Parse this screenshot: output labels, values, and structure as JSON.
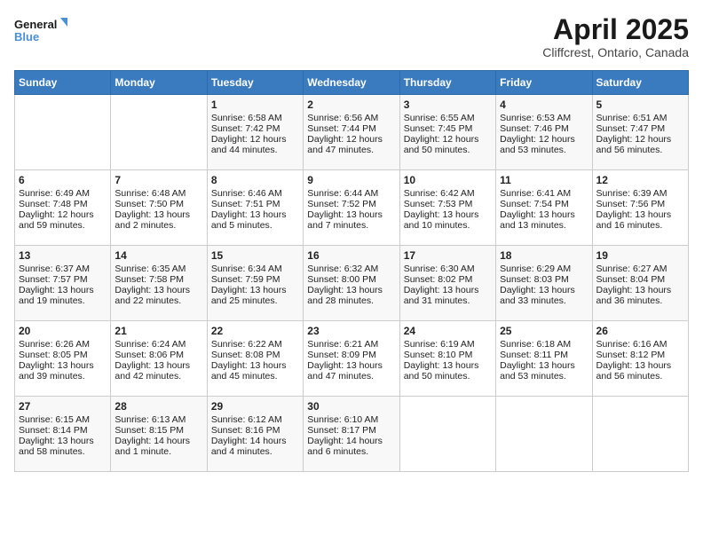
{
  "header": {
    "logo_line1": "General",
    "logo_line2": "Blue",
    "month": "April 2025",
    "location": "Cliffcrest, Ontario, Canada"
  },
  "weekdays": [
    "Sunday",
    "Monday",
    "Tuesday",
    "Wednesday",
    "Thursday",
    "Friday",
    "Saturday"
  ],
  "weeks": [
    [
      {
        "day": "",
        "info": ""
      },
      {
        "day": "",
        "info": ""
      },
      {
        "day": "1",
        "info": "Sunrise: 6:58 AM\nSunset: 7:42 PM\nDaylight: 12 hours and 44 minutes."
      },
      {
        "day": "2",
        "info": "Sunrise: 6:56 AM\nSunset: 7:44 PM\nDaylight: 12 hours and 47 minutes."
      },
      {
        "day": "3",
        "info": "Sunrise: 6:55 AM\nSunset: 7:45 PM\nDaylight: 12 hours and 50 minutes."
      },
      {
        "day": "4",
        "info": "Sunrise: 6:53 AM\nSunset: 7:46 PM\nDaylight: 12 hours and 53 minutes."
      },
      {
        "day": "5",
        "info": "Sunrise: 6:51 AM\nSunset: 7:47 PM\nDaylight: 12 hours and 56 minutes."
      }
    ],
    [
      {
        "day": "6",
        "info": "Sunrise: 6:49 AM\nSunset: 7:48 PM\nDaylight: 12 hours and 59 minutes."
      },
      {
        "day": "7",
        "info": "Sunrise: 6:48 AM\nSunset: 7:50 PM\nDaylight: 13 hours and 2 minutes."
      },
      {
        "day": "8",
        "info": "Sunrise: 6:46 AM\nSunset: 7:51 PM\nDaylight: 13 hours and 5 minutes."
      },
      {
        "day": "9",
        "info": "Sunrise: 6:44 AM\nSunset: 7:52 PM\nDaylight: 13 hours and 7 minutes."
      },
      {
        "day": "10",
        "info": "Sunrise: 6:42 AM\nSunset: 7:53 PM\nDaylight: 13 hours and 10 minutes."
      },
      {
        "day": "11",
        "info": "Sunrise: 6:41 AM\nSunset: 7:54 PM\nDaylight: 13 hours and 13 minutes."
      },
      {
        "day": "12",
        "info": "Sunrise: 6:39 AM\nSunset: 7:56 PM\nDaylight: 13 hours and 16 minutes."
      }
    ],
    [
      {
        "day": "13",
        "info": "Sunrise: 6:37 AM\nSunset: 7:57 PM\nDaylight: 13 hours and 19 minutes."
      },
      {
        "day": "14",
        "info": "Sunrise: 6:35 AM\nSunset: 7:58 PM\nDaylight: 13 hours and 22 minutes."
      },
      {
        "day": "15",
        "info": "Sunrise: 6:34 AM\nSunset: 7:59 PM\nDaylight: 13 hours and 25 minutes."
      },
      {
        "day": "16",
        "info": "Sunrise: 6:32 AM\nSunset: 8:00 PM\nDaylight: 13 hours and 28 minutes."
      },
      {
        "day": "17",
        "info": "Sunrise: 6:30 AM\nSunset: 8:02 PM\nDaylight: 13 hours and 31 minutes."
      },
      {
        "day": "18",
        "info": "Sunrise: 6:29 AM\nSunset: 8:03 PM\nDaylight: 13 hours and 33 minutes."
      },
      {
        "day": "19",
        "info": "Sunrise: 6:27 AM\nSunset: 8:04 PM\nDaylight: 13 hours and 36 minutes."
      }
    ],
    [
      {
        "day": "20",
        "info": "Sunrise: 6:26 AM\nSunset: 8:05 PM\nDaylight: 13 hours and 39 minutes."
      },
      {
        "day": "21",
        "info": "Sunrise: 6:24 AM\nSunset: 8:06 PM\nDaylight: 13 hours and 42 minutes."
      },
      {
        "day": "22",
        "info": "Sunrise: 6:22 AM\nSunset: 8:08 PM\nDaylight: 13 hours and 45 minutes."
      },
      {
        "day": "23",
        "info": "Sunrise: 6:21 AM\nSunset: 8:09 PM\nDaylight: 13 hours and 47 minutes."
      },
      {
        "day": "24",
        "info": "Sunrise: 6:19 AM\nSunset: 8:10 PM\nDaylight: 13 hours and 50 minutes."
      },
      {
        "day": "25",
        "info": "Sunrise: 6:18 AM\nSunset: 8:11 PM\nDaylight: 13 hours and 53 minutes."
      },
      {
        "day": "26",
        "info": "Sunrise: 6:16 AM\nSunset: 8:12 PM\nDaylight: 13 hours and 56 minutes."
      }
    ],
    [
      {
        "day": "27",
        "info": "Sunrise: 6:15 AM\nSunset: 8:14 PM\nDaylight: 13 hours and 58 minutes."
      },
      {
        "day": "28",
        "info": "Sunrise: 6:13 AM\nSunset: 8:15 PM\nDaylight: 14 hours and 1 minute."
      },
      {
        "day": "29",
        "info": "Sunrise: 6:12 AM\nSunset: 8:16 PM\nDaylight: 14 hours and 4 minutes."
      },
      {
        "day": "30",
        "info": "Sunrise: 6:10 AM\nSunset: 8:17 PM\nDaylight: 14 hours and 6 minutes."
      },
      {
        "day": "",
        "info": ""
      },
      {
        "day": "",
        "info": ""
      },
      {
        "day": "",
        "info": ""
      }
    ]
  ]
}
